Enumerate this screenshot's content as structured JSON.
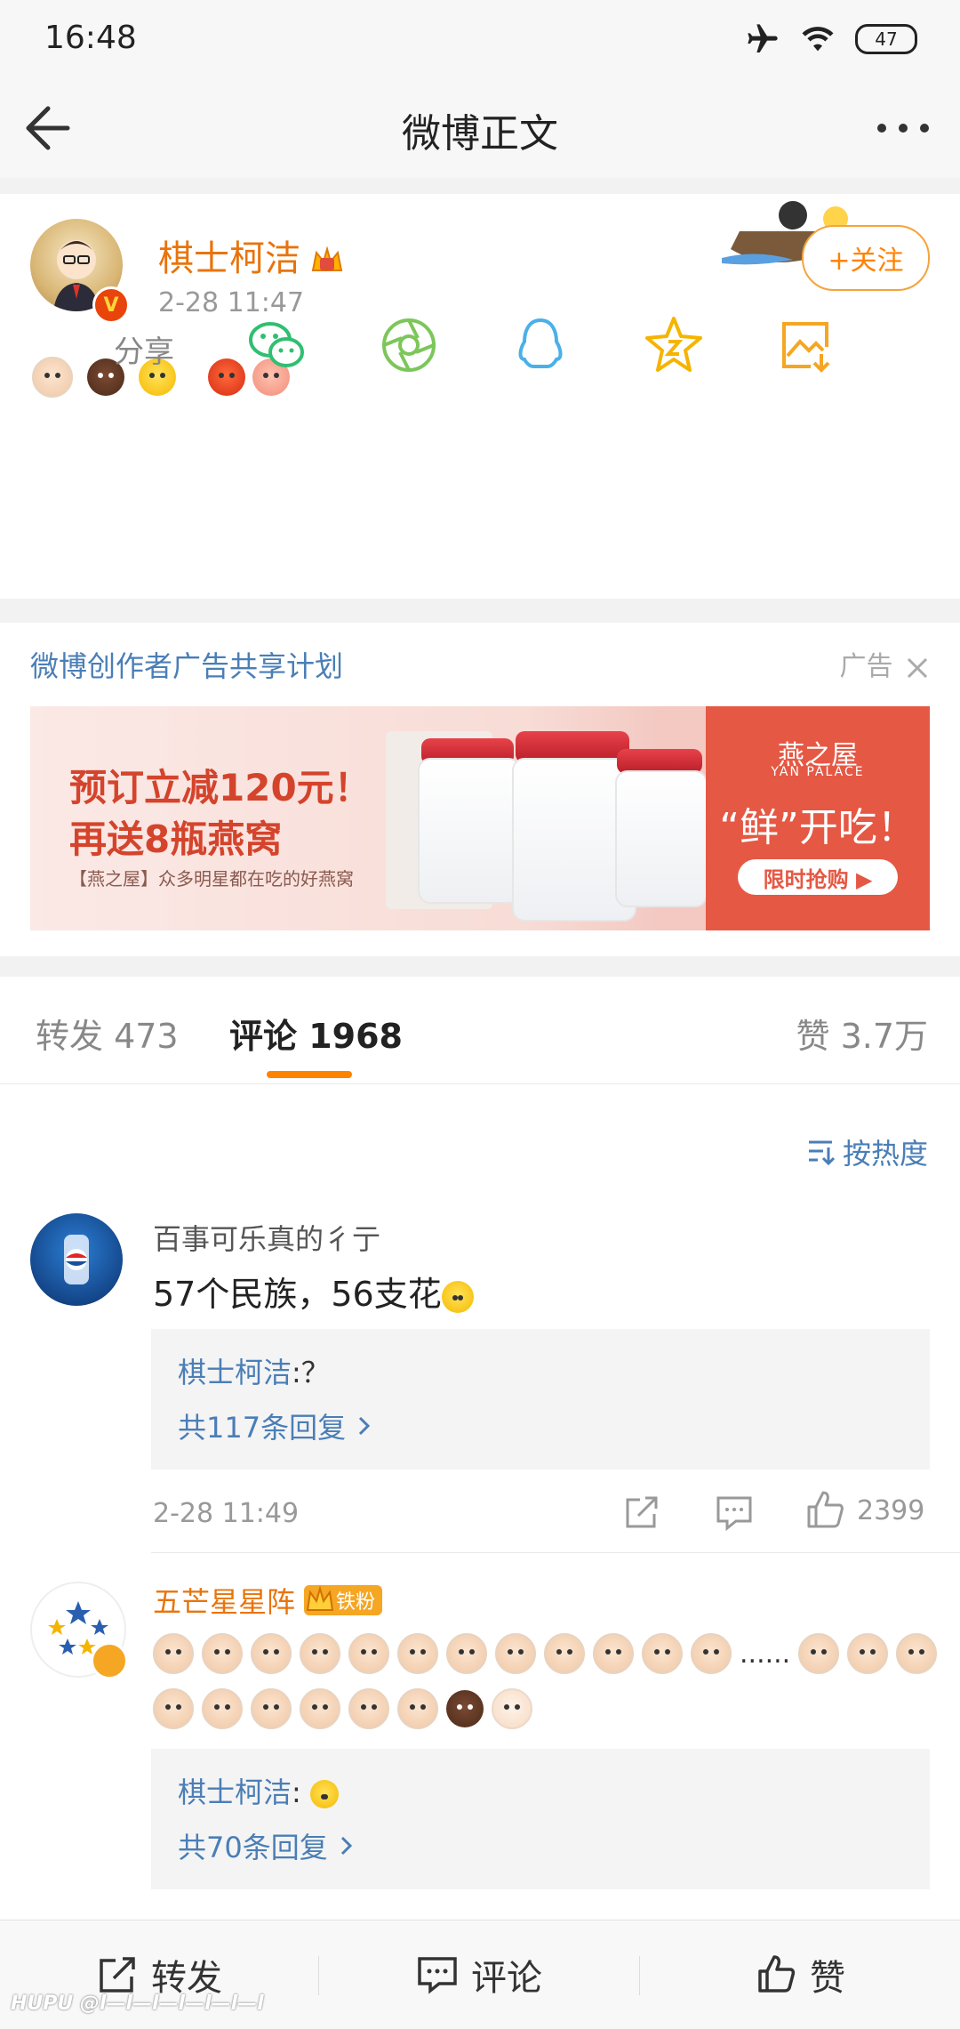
{
  "status_bar": {
    "time": "16:48",
    "battery": "47"
  },
  "nav": {
    "title": "微博正文"
  },
  "post": {
    "author": "棋士柯洁",
    "time": "2-28 11:47",
    "follow_label": "+关注",
    "verified_mark": "V",
    "share_label": "分享",
    "share_icons": [
      "wechat-icon",
      "moments-icon",
      "qq-icon",
      "favorite-icon",
      "save-image-icon"
    ]
  },
  "ad": {
    "title": "微博创作者广告共享计划",
    "tag": "广告",
    "banner_line1": "预订立减120元！",
    "banner_line2": "再送8瓶燕窝",
    "banner_line3": "【燕之屋】众多明星都在吃的好燕窝",
    "brand": "燕之屋",
    "brand_en": "YAN PALACE",
    "fresh": "“鲜”开吃！",
    "buy": "限时抢购 ▶"
  },
  "tabs": {
    "repost": "转发 473",
    "comments": "评论 1968",
    "likes": "赞 3.7万"
  },
  "sort_label": "按热度",
  "comments": [
    {
      "name": "百事可乐真的彳亍",
      "text": "57个民族，56支花",
      "reply_name": "棋士柯洁",
      "reply_text": ":？",
      "reply_count": "共117条回复",
      "time": "2-28 11:49",
      "likes": "2399"
    },
    {
      "name": "五芒星星阵",
      "fan_badge": "铁粉",
      "text_mid": "......",
      "reply_name": "棋士柯洁",
      "reply_text": ":",
      "reply_count": "共70条回复"
    }
  ],
  "bottom": {
    "repost": "转发",
    "comment": "评论",
    "like": "赞"
  },
  "watermark": "HUPU @l—l—l—l—l—l—l"
}
